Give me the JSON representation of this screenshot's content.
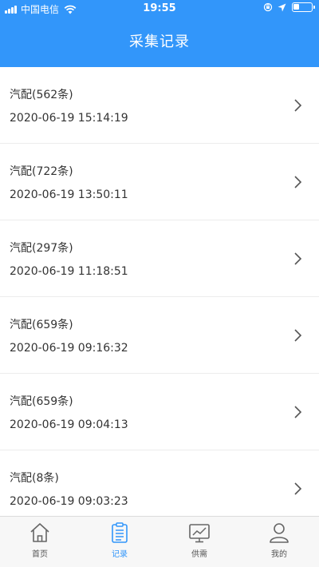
{
  "status_bar": {
    "carrier": "中国电信",
    "time": "19:55",
    "battery_level": 0.35
  },
  "header": {
    "title": "采集记录"
  },
  "records": [
    {
      "name": "汽配(562条)",
      "time": "2020-06-19 15:14:19"
    },
    {
      "name": "汽配(722条)",
      "time": "2020-06-19 13:50:11"
    },
    {
      "name": "汽配(297条)",
      "time": "2020-06-19 11:18:51"
    },
    {
      "name": "汽配(659条)",
      "time": "2020-06-19 09:16:32"
    },
    {
      "name": "汽配(659条)",
      "time": "2020-06-19 09:04:13"
    },
    {
      "name": "汽配(8条)",
      "time": "2020-06-19 09:03:23"
    }
  ],
  "tabbar": {
    "active_color": "#3296fa",
    "tabs": [
      {
        "label": "首页",
        "icon": "home-icon"
      },
      {
        "label": "记录",
        "icon": "clipboard-icon"
      },
      {
        "label": "供需",
        "icon": "chart-monitor-icon"
      },
      {
        "label": "我的",
        "icon": "user-icon"
      }
    ]
  }
}
